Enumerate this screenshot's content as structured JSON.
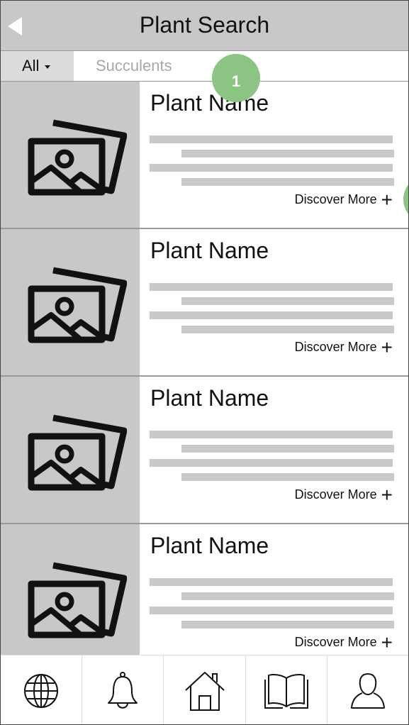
{
  "header": {
    "title": "Plant Search"
  },
  "search": {
    "filter_label": "All",
    "placeholder": "Succulents"
  },
  "badges": [
    "1",
    ""
  ],
  "cards": [
    {
      "name": "Plant Name",
      "action_label": "Discover More",
      "action_icon": "plus-icon"
    },
    {
      "name": "Plant Name",
      "action_label": "Discover More",
      "action_icon": "plus-icon"
    },
    {
      "name": "Plant Name",
      "action_label": "Discover More",
      "action_icon": "plus-icon"
    },
    {
      "name": "Plant Name",
      "action_label": "Discover More",
      "action_icon": "plus-icon"
    }
  ],
  "nav": [
    "globe-icon",
    "bell-icon",
    "home-icon",
    "book-icon",
    "user-icon"
  ],
  "colors": {
    "header_bg": "#c8c8c8",
    "badge": "#8cc483",
    "placeholder_line": "#c9c9c9"
  }
}
